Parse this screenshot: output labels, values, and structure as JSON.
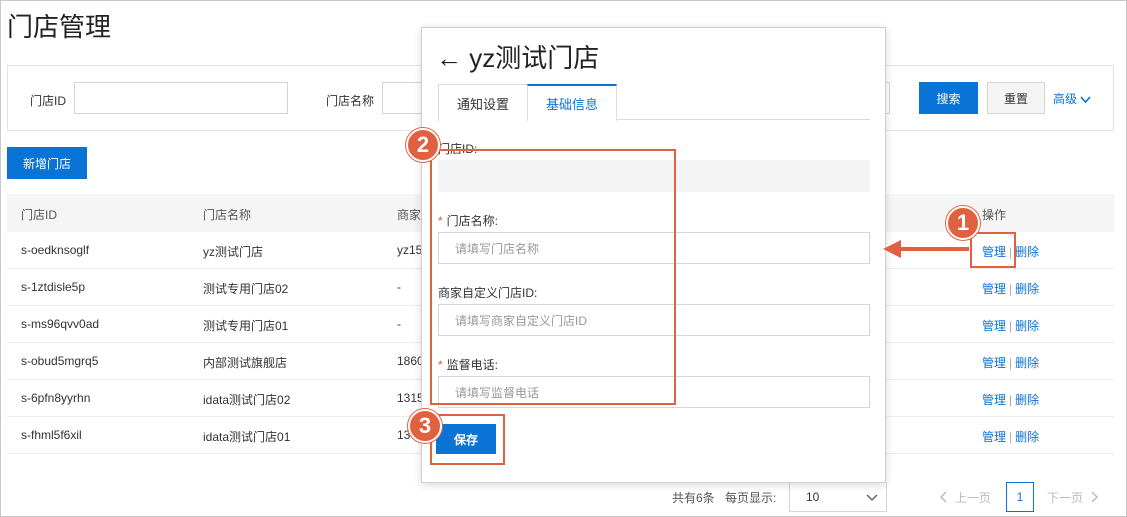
{
  "page": {
    "title": "门店管理"
  },
  "filters": {
    "store_id_label": "门店ID",
    "store_id_value": "",
    "store_name_label": "门店名称",
    "search_label": "搜索",
    "reset_label": "重置",
    "advanced_label": "高级"
  },
  "toolbar": {
    "new_store_label": "新增门店"
  },
  "table": {
    "headers": {
      "id": "门店ID",
      "name": "门店名称",
      "merchant": "商家",
      "ops": "操作"
    },
    "manage_label": "管理",
    "delete_label": "删除",
    "rows": [
      {
        "id": "s-oedknsoglf",
        "name": "yz测试门店",
        "merchant": "yz15"
      },
      {
        "id": "s-1ztdisle5p",
        "name": "测试专用门店02",
        "merchant": "-"
      },
      {
        "id": "s-ms96qvv0ad",
        "name": "测试专用门店01",
        "merchant": "-"
      },
      {
        "id": "s-obud5mgrq5",
        "name": "内部测试旗舰店",
        "merchant": "1860"
      },
      {
        "id": "s-6pfn8yyrhn",
        "name": "idata测试门店02",
        "merchant": "1315"
      },
      {
        "id": "s-fhml5f6xil",
        "name": "idata测试门店01",
        "merchant": "13"
      }
    ]
  },
  "pagination": {
    "total_text": "共有6条",
    "page_size_label": "每页显示:",
    "page_size_value": "10",
    "prev_label": "上一页",
    "current_page": "1",
    "next_label": "下一页"
  },
  "panel": {
    "back_arrow": "←",
    "title": "yz测试门店",
    "tabs": [
      {
        "label": "通知设置"
      },
      {
        "label": "基础信息"
      }
    ],
    "fields": {
      "store_id_label": "门店ID:",
      "store_id_value": "",
      "store_name_label": "门店名称:",
      "store_name_placeholder": "请填写门店名称",
      "custom_id_label": "商家自定义门店ID:",
      "custom_id_placeholder": "请填写商家自定义门店ID",
      "phone_label": "监督电话:",
      "phone_placeholder": "请填写监督电话",
      "required_mark": "*"
    },
    "save_label": "保存"
  },
  "annotations": {
    "step1": "1",
    "step2": "2",
    "step3": "3"
  },
  "colors": {
    "primary": "#0a73d6",
    "annotation": "#e0613f"
  }
}
